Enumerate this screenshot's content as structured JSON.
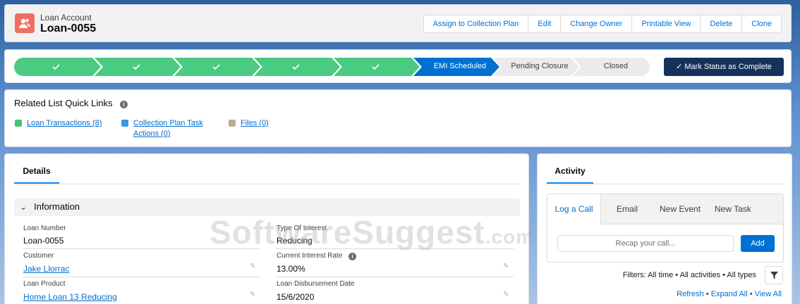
{
  "header": {
    "object_type": "Loan Account",
    "record_name": "Loan-0055",
    "actions": [
      "Assign to Collection Plan",
      "Edit",
      "Change Owner",
      "Printable View",
      "Delete",
      "Clone"
    ]
  },
  "path": {
    "completed_steps": 5,
    "current": "EMI Scheduled",
    "upcoming": [
      "Pending Closure",
      "Closed"
    ],
    "mark_complete_label": "Mark Status as Complete",
    "colors": {
      "completed": "#4bca81",
      "current": "#0070d2",
      "upcoming": "#ecebea"
    }
  },
  "quick_links": {
    "title": "Related List Quick Links",
    "items": [
      {
        "label_line1": "Loan Transactions (8)",
        "label_line2": "",
        "icon": "loan-transactions-icon",
        "color": "#4bc076"
      },
      {
        "label_line1": "Collection Plan Task",
        "label_line2": "Actions (0)",
        "icon": "task-actions-icon",
        "color": "#3c97dd"
      },
      {
        "label_line1": "Files (0)",
        "label_line2": "",
        "icon": "files-icon",
        "color": "#baac93"
      }
    ]
  },
  "details": {
    "tab": "Details",
    "section": "Information",
    "fields": {
      "loan_number": {
        "label": "Loan Number",
        "value": "Loan-0055"
      },
      "type_of_interest": {
        "label": "Type Of Interest",
        "value": "Reducing"
      },
      "customer": {
        "label": "Customer",
        "value": "Jake Llorrac"
      },
      "current_interest_rate": {
        "label": "Current Interest Rate",
        "value": "13.00%"
      },
      "loan_product": {
        "label": "Loan Product",
        "value": "Home Loan 13 Reducing"
      },
      "loan_disbursement_date": {
        "label": "Loan Disbursement Date",
        "value": "15/6/2020"
      }
    }
  },
  "activity": {
    "tab": "Activity",
    "tabs": [
      "Log a Call",
      "Email",
      "New Event",
      "New Task"
    ],
    "recap_placeholder": "Recap your call...",
    "add_label": "Add",
    "filters": "Filters: All time • All activities • All types",
    "refresh": "Refresh",
    "expand_all": "Expand All",
    "view_all": "View All"
  },
  "watermark": {
    "main": "SoftwareSuggest",
    "suffix": ".com"
  }
}
